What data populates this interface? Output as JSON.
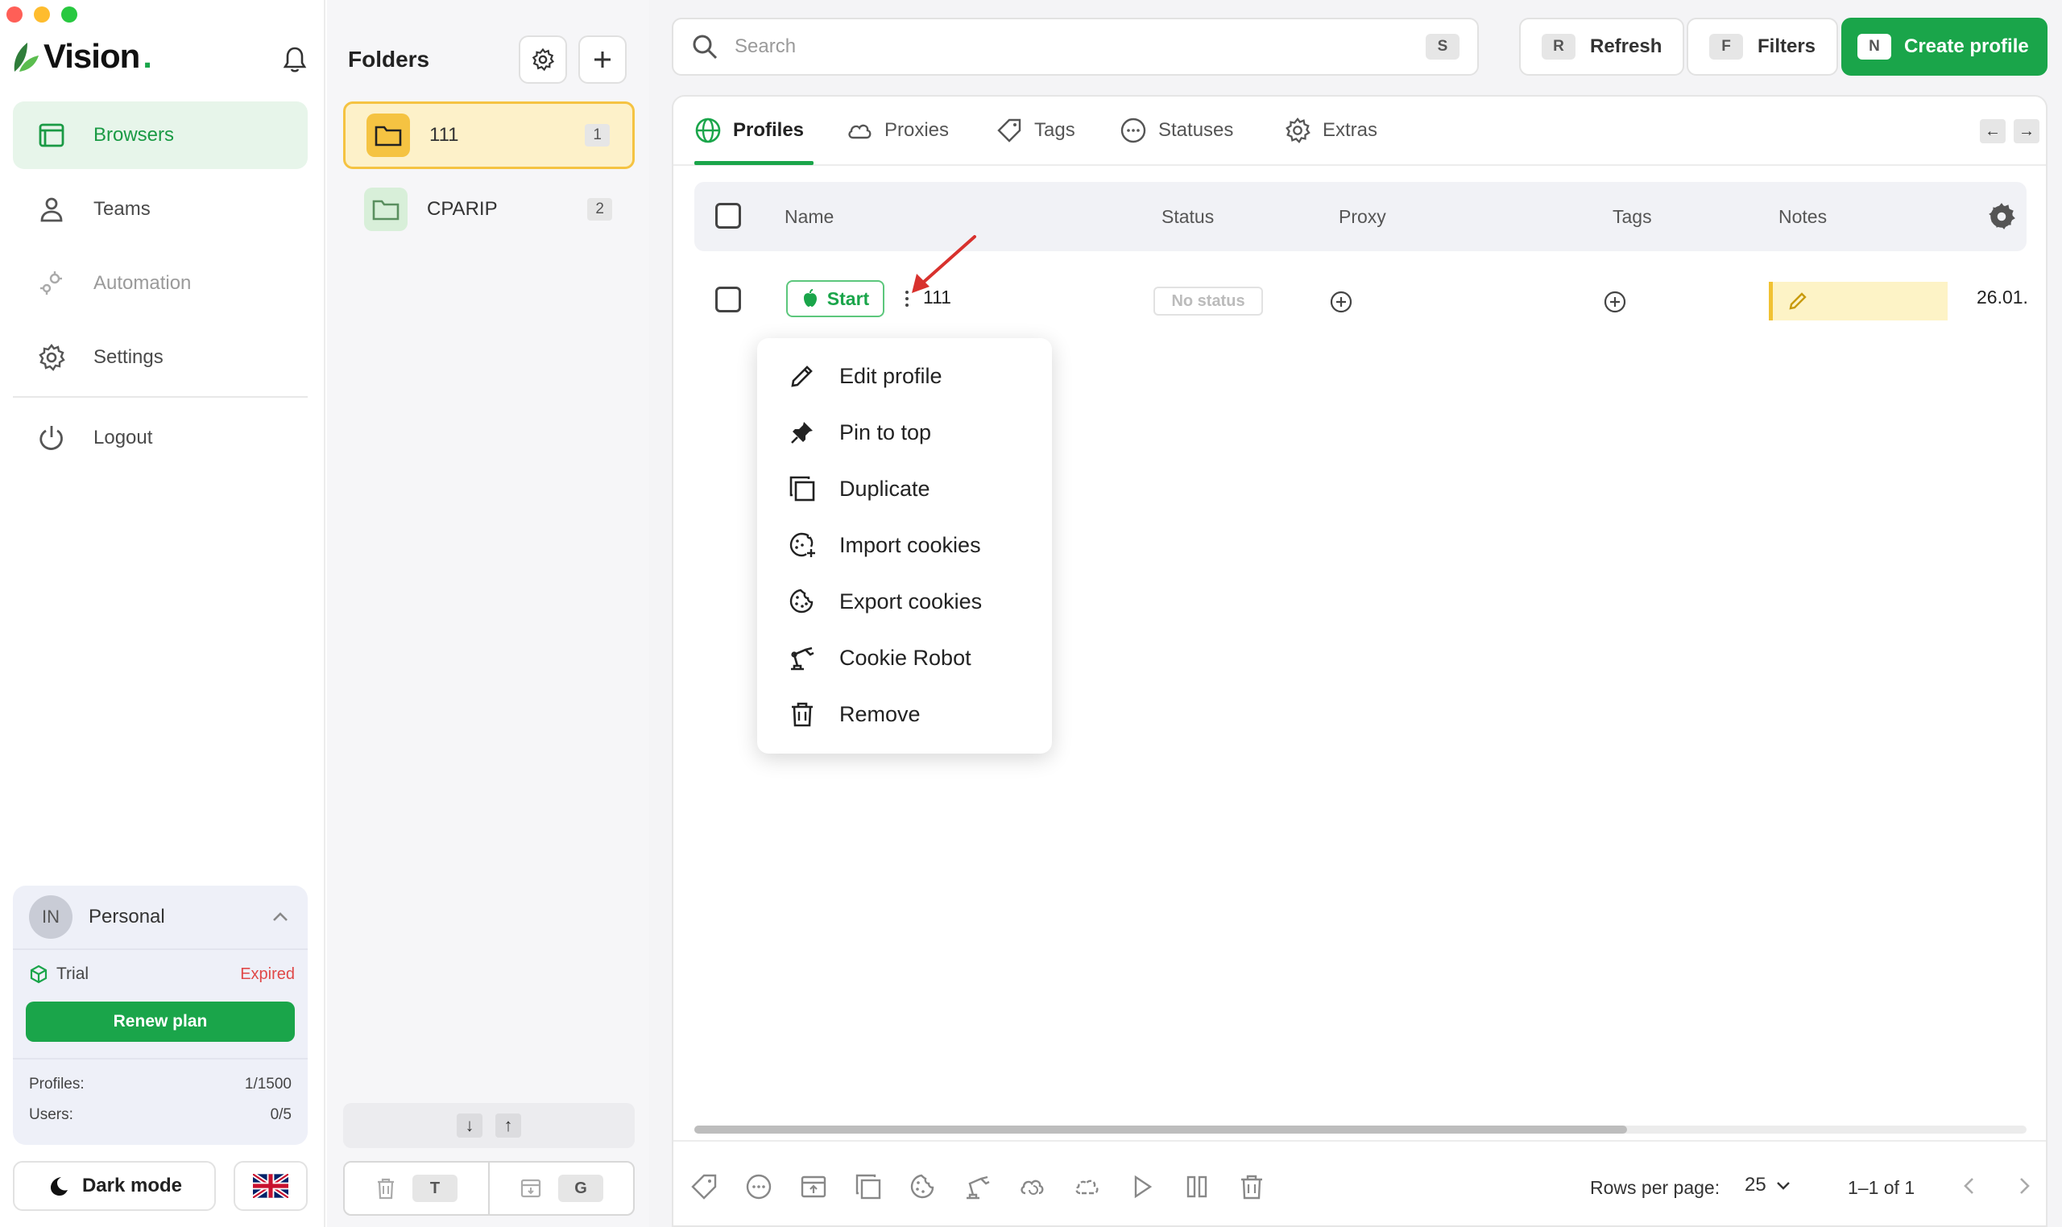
{
  "app": {
    "brand": "Vision",
    "brand_dot": ".",
    "colors": {
      "accent": "#1aa54a",
      "accent_light": "#e7f5ea",
      "folder_active_bg": "#fdf1c9",
      "folder_active_border": "#f5c342",
      "expired": "#e04848",
      "notes_bg": "#fdf3c6"
    }
  },
  "sidebar": {
    "items": [
      {
        "label": "Browsers",
        "icon": "browser-window-icon",
        "active": true
      },
      {
        "label": "Teams",
        "icon": "person-icon",
        "active": false
      },
      {
        "label": "Automation",
        "icon": "gears-icon",
        "active": false,
        "disabled": true
      },
      {
        "label": "Settings",
        "icon": "gear-icon",
        "active": false
      },
      {
        "label": "Logout",
        "icon": "power-icon",
        "active": false
      }
    ],
    "plan": {
      "avatar_initials": "IN",
      "workspace": "Personal",
      "plan_name": "Trial",
      "plan_status": "Expired",
      "renew_label": "Renew plan",
      "profiles_label": "Profiles:",
      "profiles_value": "1/1500",
      "users_label": "Users:",
      "users_value": "0/5"
    },
    "dark_mode_label": "Dark mode"
  },
  "folders": {
    "title": "Folders",
    "items": [
      {
        "name": "111",
        "count": "1",
        "active": true
      },
      {
        "name": "CPARIP",
        "count": "2",
        "active": false
      }
    ],
    "sort_down": "↓",
    "sort_up": "↑",
    "delete_key": "T",
    "archive_key": "G"
  },
  "toolbar": {
    "search_placeholder": "Search",
    "search_key": "S",
    "refresh_key": "R",
    "refresh_label": "Refresh",
    "filters_key": "F",
    "filters_label": "Filters",
    "create_key": "N",
    "create_label": "Create profile"
  },
  "tabs": [
    {
      "label": "Profiles",
      "icon": "globe-icon",
      "active": true
    },
    {
      "label": "Proxies",
      "icon": "cloud-icon",
      "active": false
    },
    {
      "label": "Tags",
      "icon": "tag-icon",
      "active": false
    },
    {
      "label": "Statuses",
      "icon": "dots-circle-icon",
      "active": false
    },
    {
      "label": "Extras",
      "icon": "gear-icon",
      "active": false
    }
  ],
  "tab_nav": {
    "left": "←",
    "right": "→"
  },
  "table": {
    "columns": [
      "Name",
      "Status",
      "Proxy",
      "Tags",
      "Notes"
    ],
    "rows": [
      {
        "start_label": "Start",
        "name": "111",
        "status": "No status",
        "date": "26.01."
      }
    ]
  },
  "context_menu": {
    "items": [
      {
        "label": "Edit profile",
        "icon": "pencil-icon"
      },
      {
        "label": "Pin to top",
        "icon": "pin-icon"
      },
      {
        "label": "Duplicate",
        "icon": "duplicate-icon"
      },
      {
        "label": "Import cookies",
        "icon": "cookie-import-icon"
      },
      {
        "label": "Export cookies",
        "icon": "cookie-export-icon"
      },
      {
        "label": "Cookie Robot",
        "icon": "robot-arm-icon"
      },
      {
        "label": "Remove",
        "icon": "trash-icon"
      }
    ]
  },
  "footer": {
    "rows_per_page_label": "Rows per page:",
    "rows_per_page_value": "25",
    "pagination_text": "1–1 of 1",
    "scroll_fraction": 0.7
  }
}
